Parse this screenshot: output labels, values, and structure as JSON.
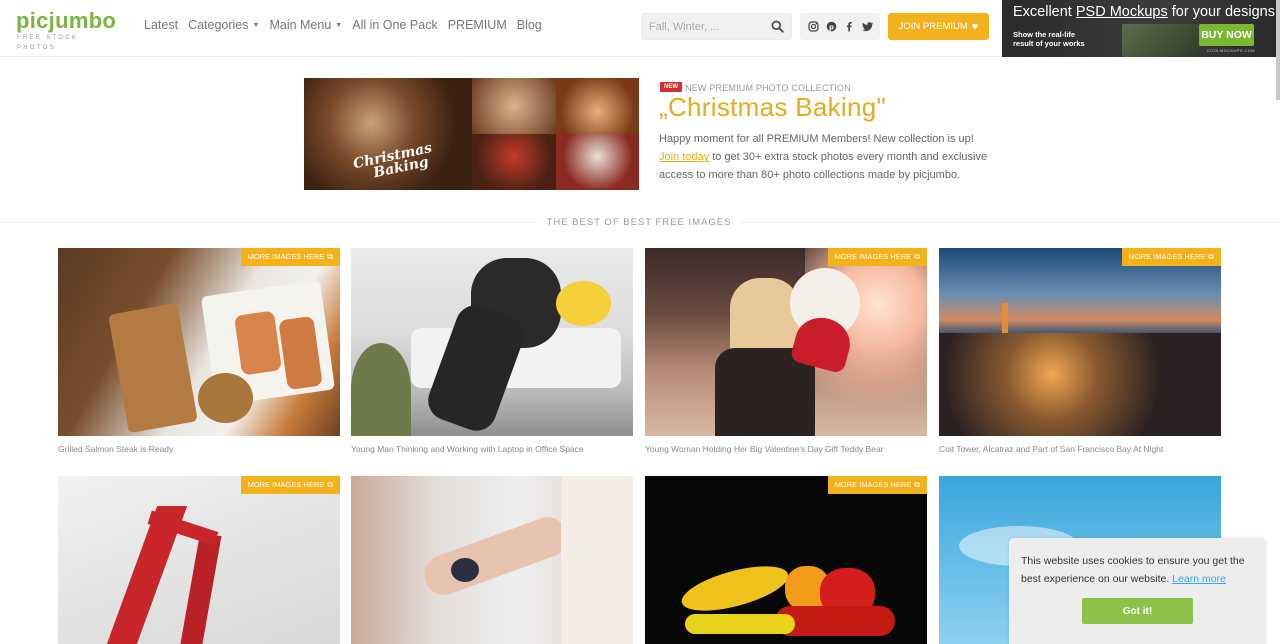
{
  "header": {
    "logo": "picjumbo",
    "logo_tagline": "FREE STOCK PHOTOS",
    "nav": [
      {
        "label": "Latest",
        "dropdown": false
      },
      {
        "label": "Categories",
        "dropdown": true
      },
      {
        "label": "Main Menu",
        "dropdown": true
      },
      {
        "label": "All in One Pack",
        "dropdown": false
      },
      {
        "label": "PREMIUM",
        "dropdown": false
      },
      {
        "label": "Blog",
        "dropdown": false
      }
    ],
    "search_placeholder": "Fall, Winter, ...",
    "social_icons": [
      "instagram-icon",
      "pinterest-icon",
      "facebook-icon",
      "twitter-icon"
    ],
    "join_label": "JOIN PREMIUM",
    "accent_color": "#f3b11b",
    "brand_color": "#7cb342"
  },
  "ad": {
    "title_prefix": "Excellent ",
    "title_link": "PSD Mockups",
    "title_suffix": " for your designs",
    "subtitle_line1": "Show the real-life",
    "subtitle_line2": "result of your works",
    "buy_label": "BUY NOW",
    "domain": "COOLMOCKUPS.COM"
  },
  "promo": {
    "badge": "NEW",
    "kicker": "NEW PREMIUM PHOTO COLLECTION",
    "title": "„Christmas Baking\"",
    "image_script_line1": "Christmas",
    "image_script_line2": "Baking",
    "text_before": "Happy moment for all PREMIUM Members! New collection is up!",
    "link": "Join today",
    "text_after": " to get 30+ extra stock photos every month and exclusive access to more than 80+ photo collections made by picjumbo."
  },
  "section_label": "THE BEST OF BEST FREE IMAGES",
  "more_label": "MORE IMAGES HERE",
  "cards": [
    {
      "caption": "Grilled Salmon Steak is Ready",
      "more": true
    },
    {
      "caption": "Young Man Thinking and Working with Laptop in Office Space",
      "more": false
    },
    {
      "caption": "Young Woman Holding Her Big Valentine's Day Gift Teddy Bear",
      "more": true
    },
    {
      "caption": "Coit Tower, Alcatraz and Part of San Francisco Bay At Night",
      "more": true
    },
    {
      "caption": "",
      "more": true
    },
    {
      "caption": "",
      "more": false
    },
    {
      "caption": "",
      "more": true
    },
    {
      "caption": "",
      "more": false
    }
  ],
  "cookie": {
    "text": "This website uses cookies to ensure you get the best experience on our website.",
    "link": "Learn more",
    "button": "Got it!"
  }
}
